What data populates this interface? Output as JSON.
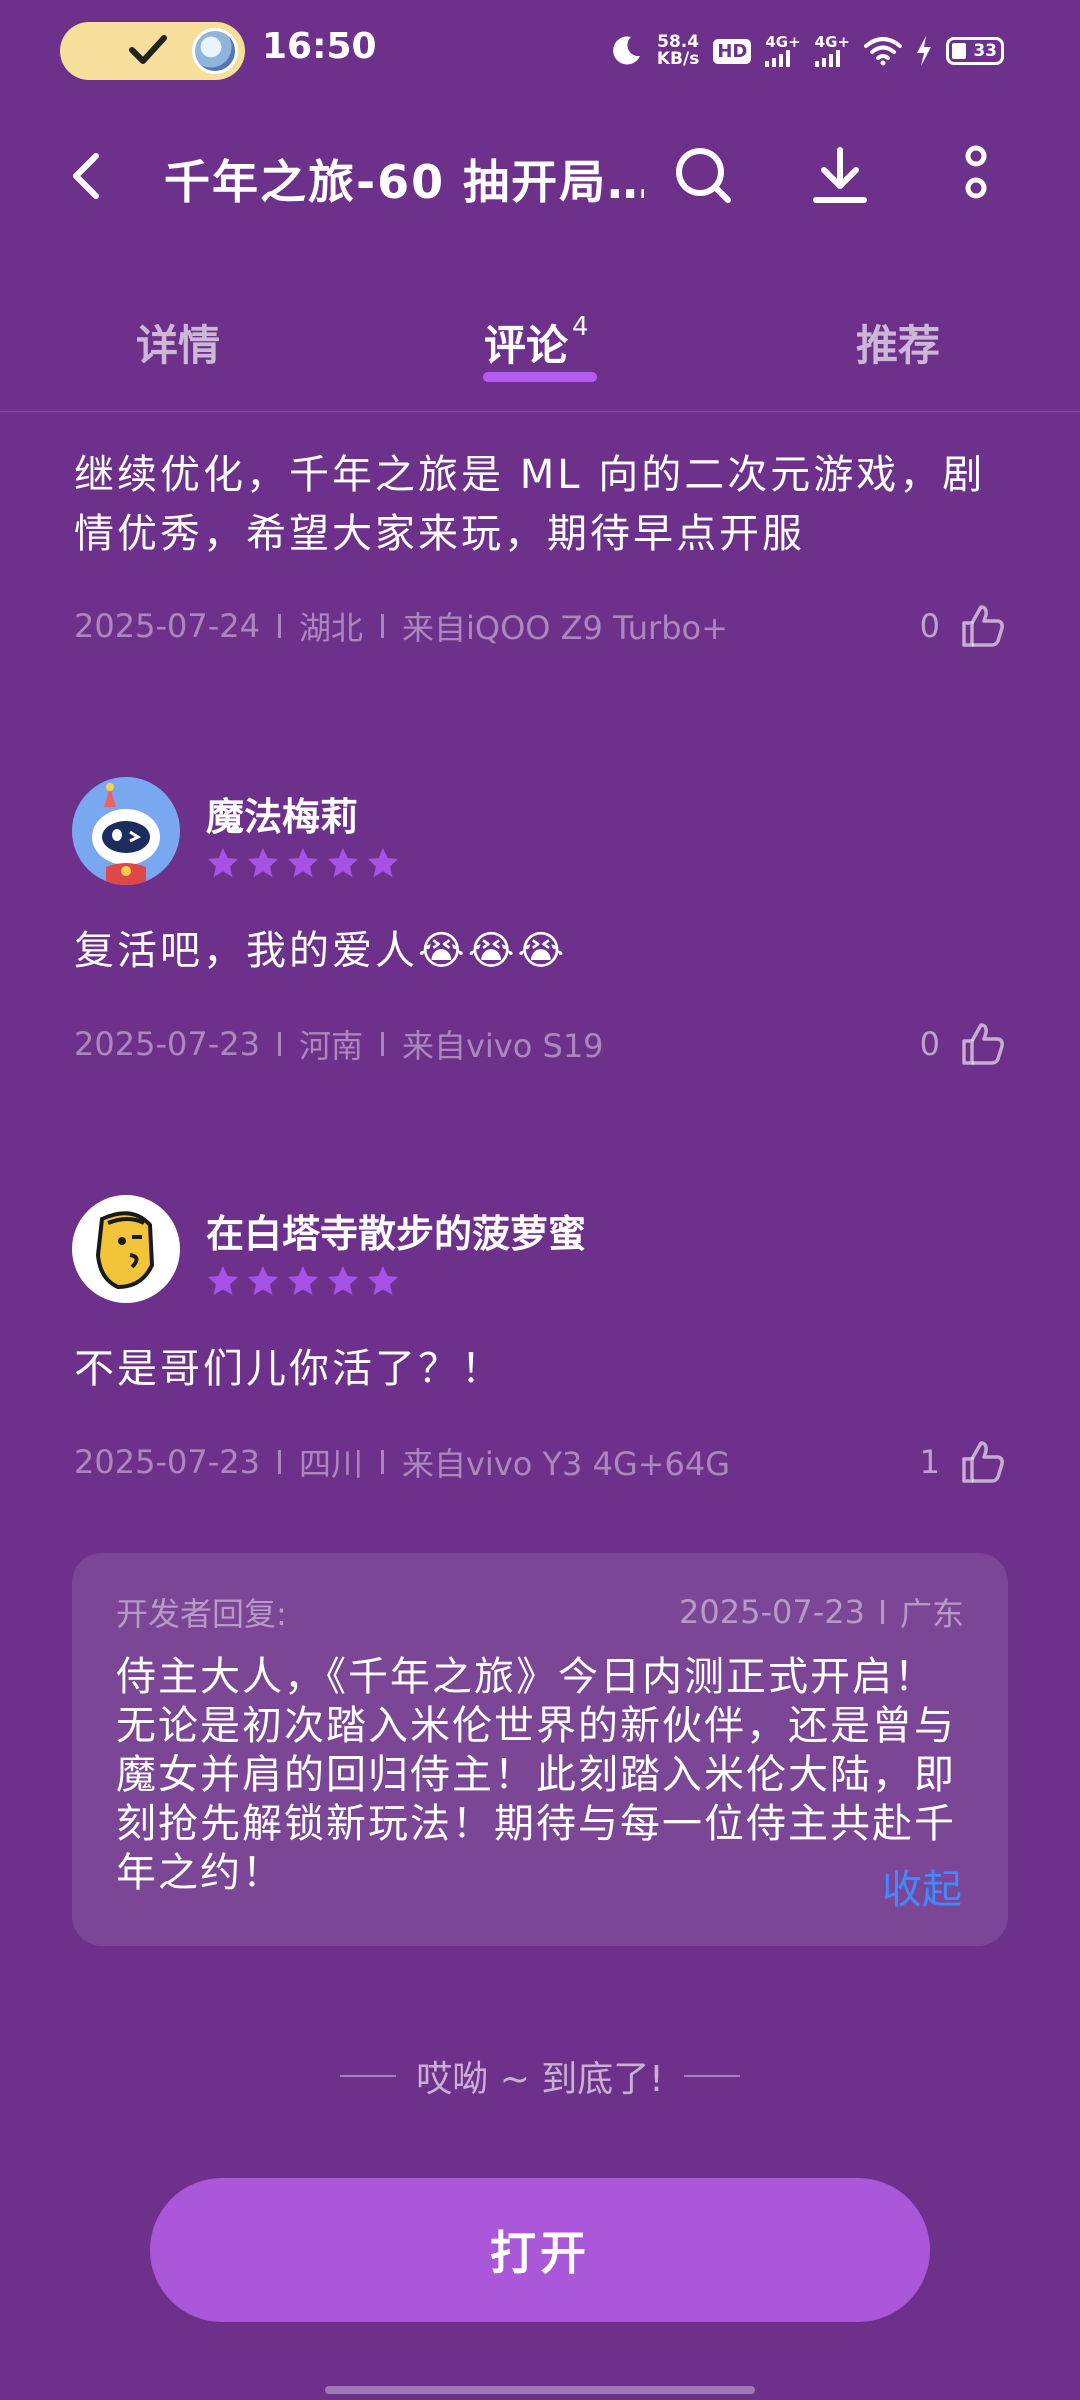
{
  "status_bar": {
    "time": "16:50",
    "net_speed": "58.4",
    "net_speed_unit": "KB/s",
    "hd_label": "HD",
    "network_1": "4G+",
    "network_2": "4G+",
    "battery": "33"
  },
  "header": {
    "title": "千年之旅-60 抽开局…",
    "back_icon": "back-arrow-icon",
    "search_icon": "search-icon",
    "download_icon": "download-icon",
    "more_icon": "more-vertical-icon"
  },
  "tabs": [
    {
      "label": "详情"
    },
    {
      "label": "评论",
      "count": "4"
    },
    {
      "label": "推荐"
    }
  ],
  "comments": [
    {
      "text": "继续优化，千年之旅是 ML 向的二次元游戏，剧情优秀，希望大家来玩，期待早点开服",
      "date": "2025-07-24",
      "region": "湖北",
      "device": "来自iQOO Z9 Turbo+",
      "likes": "0"
    },
    {
      "username": "魔法梅莉",
      "rating": 5,
      "text": "复活吧，我的爱人😭😭😭",
      "date": "2025-07-23",
      "region": "河南",
      "device": "来自vivo S19",
      "likes": "0"
    },
    {
      "username": "在白塔寺散步的菠萝蜜",
      "rating": 5,
      "text": "不是哥们儿你活了？！",
      "date": "2025-07-23",
      "region": "四川",
      "device": "来自vivo Y3 4G+64G",
      "likes": "1"
    }
  ],
  "developer_reply": {
    "label": "开发者回复:",
    "date": "2025-07-23",
    "region": "广东",
    "text": "侍主大人，《千年之旅》今日内测正式开启！无论是初次踏入米伦世界的新伙伴，还是曾与魔女并肩的回归侍主！此刻踏入米伦大陆，即刻抢先解锁新玩法！期待与每一位侍主共赴千年之约！",
    "collapse_label": "收起"
  },
  "end_text": "哎呦 ~ 到底了!",
  "open_button": "打开",
  "colors": {
    "background": "#6e318b",
    "accent": "#aa57d9",
    "star": "#a552e6",
    "link": "#3d8bff"
  }
}
